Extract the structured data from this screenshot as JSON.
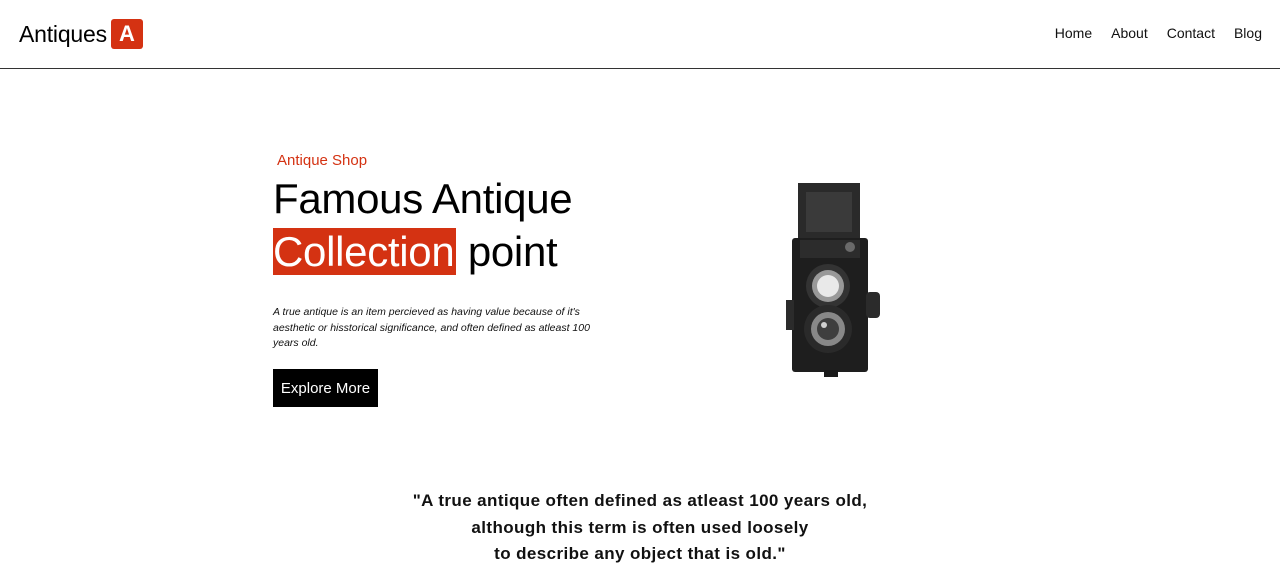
{
  "brand": {
    "name": "Antiques",
    "badge": "A",
    "accent": "#d43212"
  },
  "nav": [
    {
      "label": "Home"
    },
    {
      "label": "About"
    },
    {
      "label": "Contact"
    },
    {
      "label": "Blog"
    }
  ],
  "hero": {
    "eyebrow": "Antique Shop",
    "title_line1": "Famous Antique",
    "title_highlight": "Collection",
    "title_end": "point",
    "description": "A true antique is an item percieved as having value because of it's aesthetic or hisstorical significance, and often defined as atleast 100 years old.",
    "cta_label": "Explore More",
    "image": "vintage-twin-lens-camera"
  },
  "quote": {
    "line1": "\"A true antique often defined as atleast 100 years old,",
    "line2": "although this term is often used loosely",
    "line3": "to describe any object that is old.\""
  }
}
